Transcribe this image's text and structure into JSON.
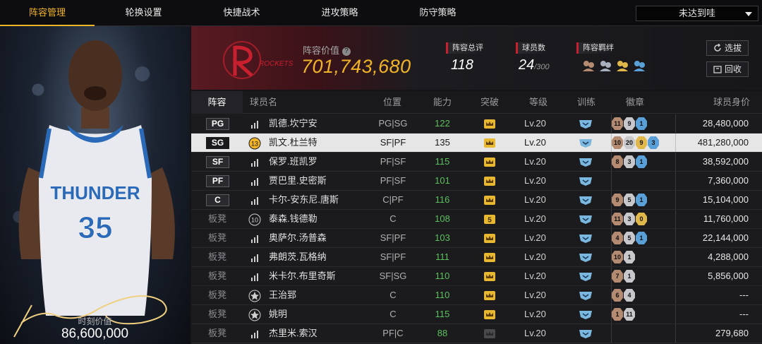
{
  "nav": {
    "tabs": [
      {
        "label": "阵容管理",
        "active": true
      },
      {
        "label": "轮换设置",
        "active": false
      },
      {
        "label": "快捷战术",
        "active": false
      },
      {
        "label": "进攻策略",
        "active": false
      },
      {
        "label": "防守策略",
        "active": false
      }
    ],
    "dropdown_value": "未达到哇"
  },
  "player_card": {
    "jersey_team": "THUNDER",
    "jersey_number": "35",
    "moment_label": "时刻价值",
    "moment_value": "86,600,000"
  },
  "team": {
    "logo_text": "ROCKETS",
    "value_label": "阵容价值",
    "value": "701,743,680",
    "rating_label": "阵容总评",
    "rating": "118",
    "players_label": "球员数",
    "players_count": "24",
    "players_max": "/300",
    "bond_label": "阵容羁绊",
    "select_button": "选拔",
    "recycle_button": "回收"
  },
  "table": {
    "headers": {
      "lineup": "阵容",
      "name": "球员名",
      "position": "位置",
      "ability": "能力",
      "breakthrough": "突破",
      "level": "等级",
      "training": "训练",
      "badges": "徽章",
      "value": "球员身价"
    },
    "rows": [
      {
        "slot": "PG",
        "starter": true,
        "icon": "bars",
        "name": "凯德.坎宁安",
        "position": "PG|SG",
        "ability": "122",
        "break": "crown",
        "level": "Lv.20",
        "badges": [
          {
            "t": "bronze",
            "v": "11"
          },
          {
            "t": "silver",
            "v": "9"
          },
          {
            "t": "blue",
            "v": "1"
          }
        ],
        "value": "28,480,000"
      },
      {
        "slot": "SG",
        "starter": true,
        "selected": true,
        "icon": "13",
        "name": "凯文.杜兰特",
        "position": "SF|PF",
        "ability": "135",
        "break": "crown",
        "level": "Lv.20",
        "badges": [
          {
            "t": "bronze",
            "v": "10"
          },
          {
            "t": "silver",
            "v": "20"
          },
          {
            "t": "gold",
            "v": "9"
          },
          {
            "t": "blue",
            "v": "3"
          }
        ],
        "value": "481,280,000"
      },
      {
        "slot": "SF",
        "starter": true,
        "icon": "bars",
        "name": "保罗.班凯罗",
        "position": "PF|SF",
        "ability": "115",
        "break": "crown",
        "level": "Lv.20",
        "badges": [
          {
            "t": "bronze",
            "v": "8"
          },
          {
            "t": "silver",
            "v": "3"
          },
          {
            "t": "blue",
            "v": "1"
          }
        ],
        "value": "38,592,000"
      },
      {
        "slot": "PF",
        "starter": true,
        "icon": "bars",
        "name": "贾巴里.史密斯",
        "position": "PF|SF",
        "ability": "101",
        "break": "crown",
        "level": "Lv.20",
        "badges": [],
        "value": "7,360,000"
      },
      {
        "slot": "C",
        "starter": true,
        "icon": "bars",
        "name": "卡尔-安东尼.唐斯",
        "position": "C|PF",
        "ability": "116",
        "break": "crown",
        "level": "Lv.20",
        "badges": [
          {
            "t": "bronze",
            "v": "9"
          },
          {
            "t": "silver",
            "v": "5"
          },
          {
            "t": "blue",
            "v": "1"
          }
        ],
        "value": "15,104,000"
      },
      {
        "slot": "板凳",
        "starter": false,
        "icon": "10",
        "name": "泰森.钱德勒",
        "position": "C",
        "ability": "108",
        "break": "5",
        "level": "Lv.20",
        "badges": [
          {
            "t": "bronze",
            "v": "11"
          },
          {
            "t": "silver",
            "v": "3"
          },
          {
            "t": "gold",
            "v": "0"
          }
        ],
        "value": "11,760,000"
      },
      {
        "slot": "板凳",
        "starter": false,
        "icon": "bars",
        "name": "奥萨尔.汤普森",
        "position": "SF|PF",
        "ability": "103",
        "break": "crown",
        "level": "Lv.20",
        "badges": [
          {
            "t": "bronze",
            "v": "4"
          },
          {
            "t": "silver",
            "v": "5"
          },
          {
            "t": "blue",
            "v": "1"
          }
        ],
        "value": "22,144,000"
      },
      {
        "slot": "板凳",
        "starter": false,
        "icon": "bars",
        "name": "弗朗茨.瓦格纳",
        "position": "SF|PF",
        "ability": "111",
        "break": "crown",
        "level": "Lv.20",
        "badges": [
          {
            "t": "bronze",
            "v": "10"
          },
          {
            "t": "silver",
            "v": "1"
          }
        ],
        "value": "4,288,000"
      },
      {
        "slot": "板凳",
        "starter": false,
        "icon": "bars",
        "name": "米卡尔.布里奇斯",
        "position": "SF|SG",
        "ability": "110",
        "break": "crown",
        "level": "Lv.20",
        "badges": [
          {
            "t": "bronze",
            "v": "7"
          },
          {
            "t": "silver",
            "v": "1"
          }
        ],
        "value": "5,856,000"
      },
      {
        "slot": "板凳",
        "starter": false,
        "icon": "star",
        "name": "王治郅",
        "position": "C",
        "ability": "110",
        "break": "crown",
        "level": "Lv.20",
        "badges": [
          {
            "t": "bronze",
            "v": "6"
          },
          {
            "t": "silver",
            "v": "4"
          }
        ],
        "value": "---"
      },
      {
        "slot": "板凳",
        "starter": false,
        "icon": "star",
        "name": "姚明",
        "position": "C",
        "ability": "115",
        "break": "crown",
        "level": "Lv.20",
        "badges": [
          {
            "t": "bronze",
            "v": "1"
          },
          {
            "t": "silver",
            "v": "11"
          }
        ],
        "value": "---"
      },
      {
        "slot": "板凳",
        "starter": false,
        "icon": "bars",
        "name": "杰里米.索汉",
        "position": "PF|C",
        "ability": "88",
        "break": "dim",
        "level": "Lv.20",
        "badges": [],
        "value": "279,680"
      }
    ]
  },
  "colors": {
    "accent": "#f0b429",
    "ability_green": "#5cc05c",
    "rocket_red": "#c8202e"
  }
}
